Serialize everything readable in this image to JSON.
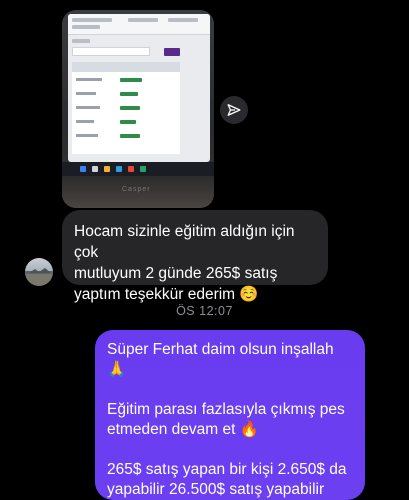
{
  "incoming": {
    "line1": "Hocam sizinle eğitim aldığın için çok",
    "line2": "mutluyum 2 günde 265$ satış",
    "line3": "yaptım teşekkür ederim ☺️"
  },
  "timestamp": "ÖS 12:07",
  "outgoing": {
    "para1": "Süper Ferhat daim olsun inşallah 🙏",
    "para2_line1": "Eğitim parası fazlasıyla çıkmış pes",
    "para2_line2": "etmeden devam et 🔥",
    "para3_line1": "265$ satış yapan bir kişi 2.650$ da",
    "para3_line2": "yapabilir 26.500$ satış yapabilir"
  },
  "photo": {
    "brand_text": "Casper"
  },
  "icons": {
    "share": "send-icon",
    "avatar": "avatar"
  },
  "colors": {
    "background": "#000000",
    "incoming_bubble": "#262629",
    "outgoing_bubble": "#6a3cf0",
    "timestamp": "#8e8e93"
  }
}
